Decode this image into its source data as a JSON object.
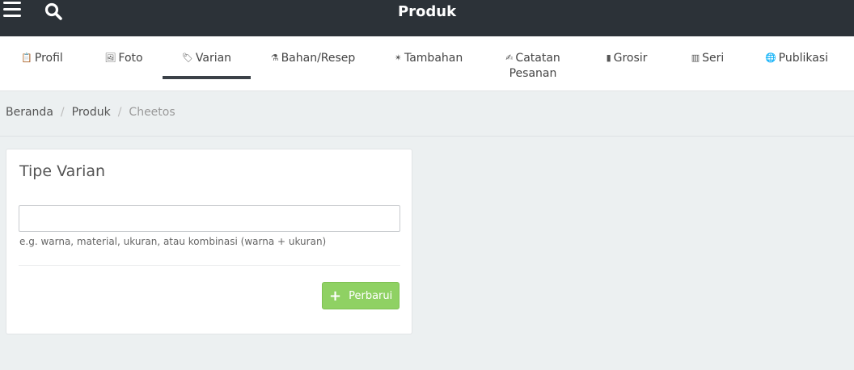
{
  "header": {
    "title": "Produk",
    "menu_icon": "hamburger-menu-icon",
    "search_icon": "search-icon"
  },
  "tabs": [
    {
      "label": "Profil",
      "icon": "clipboard-icon",
      "glyph": "📋"
    },
    {
      "label": "Foto",
      "icon": "image-icon",
      "glyph": "🖼"
    },
    {
      "label": "Varian",
      "icon": "tag-icon",
      "glyph": "🏷"
    },
    {
      "label": "Bahan/Resep",
      "icon": "flask-icon",
      "glyph": "⚗"
    },
    {
      "label": "Tambahan",
      "icon": "sparkle-icon",
      "glyph": "✴"
    },
    {
      "label": "Catatan",
      "label2": "Pesanan",
      "icon": "note-icon",
      "glyph": "✍"
    },
    {
      "label": "Grosir",
      "icon": "bookmark-icon",
      "glyph": "▮"
    },
    {
      "label": "Seri",
      "icon": "barcode-icon",
      "glyph": "▥"
    },
    {
      "label": "Publikasi",
      "icon": "globe-icon",
      "glyph": "🌐"
    }
  ],
  "active_tab": "Varian",
  "breadcrumb": {
    "items": [
      "Beranda",
      "Produk"
    ],
    "current": "Cheetos",
    "separator": "/"
  },
  "variant_card": {
    "title": "Tipe Varian",
    "input_value": "",
    "input_placeholder": "",
    "help_text": "e.g. warna, material, ukuran, atau kombinasi (warna + ukuran)",
    "button_label": "Perbarui",
    "button_icon": "plus-icon",
    "button_color": "#8fd163"
  },
  "colors": {
    "topbar": "#2c3238",
    "background": "#ecf0f1",
    "accent": "#8fd163"
  }
}
